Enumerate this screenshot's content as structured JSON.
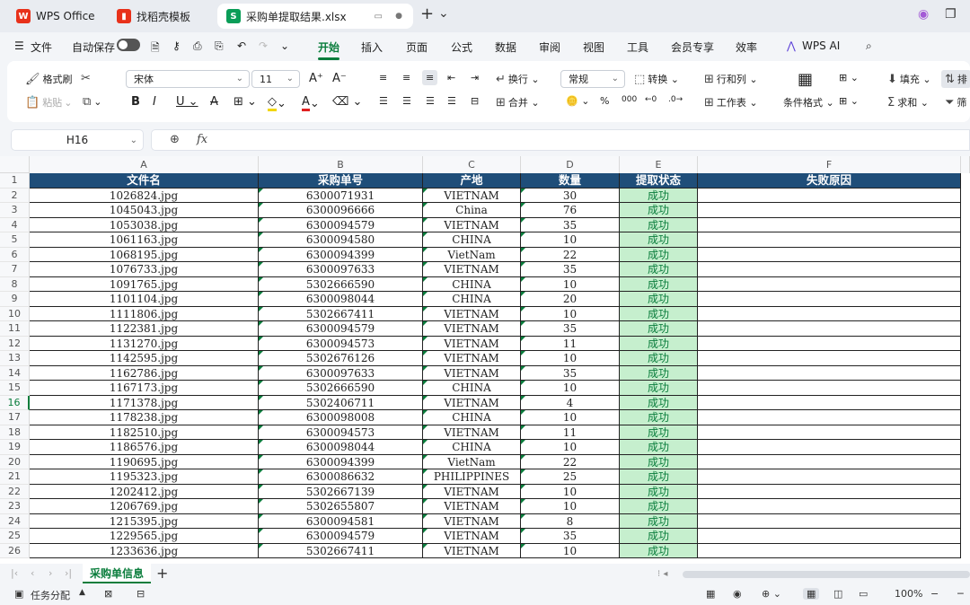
{
  "titlebar": {
    "tabs": [
      {
        "label": "WPS Office",
        "icon": "wps-logo-icon",
        "color": "#e8311a"
      },
      {
        "label": "找稻壳模板",
        "icon": "docer-icon",
        "color": "#e8311a"
      },
      {
        "label": "采购单提取结果.xlsx",
        "icon": "spreadsheet-s-icon",
        "color": "#0a9d58"
      }
    ],
    "new_tab": "+",
    "tab_list": "⌄"
  },
  "menu": {
    "file": "文件",
    "autosave": "自动保存",
    "tabs": [
      "开始",
      "插入",
      "页面",
      "公式",
      "数据",
      "审阅",
      "视图",
      "工具",
      "会员专享",
      "效率"
    ],
    "ai": "WPS AI"
  },
  "ribbon": {
    "format_painter": "格式刷",
    "paste": "粘贴",
    "font_name": "宋体",
    "font_size": "11",
    "wrap": "换行",
    "merge": "合并",
    "number_format": "常规",
    "convert": "转换",
    "rows_cols": "行和列",
    "worksheet": "工作表",
    "cond_format": "条件格式",
    "fill": "填充",
    "sum": "求和",
    "sort": "排",
    "filter": "筛"
  },
  "formula": {
    "cell_ref": "H16",
    "fx": "fx",
    "value": ""
  },
  "columns": [
    "A",
    "B",
    "C",
    "D",
    "E",
    "F"
  ],
  "headers": [
    "文件名",
    "采购单号",
    "产地",
    "数量",
    "提取状态",
    "失败原因"
  ],
  "rows": [
    [
      "1026824.jpg",
      "6300071931",
      "VIETNAM",
      "30",
      "成功",
      ""
    ],
    [
      "1045043.jpg",
      "6300096666",
      "China",
      "76",
      "成功",
      ""
    ],
    [
      "1053038.jpg",
      "6300094579",
      "VIETNAM",
      "35",
      "成功",
      ""
    ],
    [
      "1061163.jpg",
      "6300094580",
      "CHINA",
      "10",
      "成功",
      ""
    ],
    [
      "1068195.jpg",
      "6300094399",
      "VietNam",
      "22",
      "成功",
      ""
    ],
    [
      "1076733.jpg",
      "6300097633",
      "VIETNAM",
      "35",
      "成功",
      ""
    ],
    [
      "1091765.jpg",
      "5302666590",
      "CHINA",
      "10",
      "成功",
      ""
    ],
    [
      "1101104.jpg",
      "6300098044",
      "CHINA",
      "20",
      "成功",
      ""
    ],
    [
      "1111806.jpg",
      "5302667411",
      "VIETNAM",
      "10",
      "成功",
      ""
    ],
    [
      "1122381.jpg",
      "6300094579",
      "VIETNAM",
      "35",
      "成功",
      ""
    ],
    [
      "1131270.jpg",
      "6300094573",
      "VIETNAM",
      "11",
      "成功",
      ""
    ],
    [
      "1142595.jpg",
      "5302676126",
      "VIETNAM",
      "10",
      "成功",
      ""
    ],
    [
      "1162786.jpg",
      "6300097633",
      "VIETNAM",
      "35",
      "成功",
      ""
    ],
    [
      "1167173.jpg",
      "5302666590",
      "CHINA",
      "10",
      "成功",
      ""
    ],
    [
      "1171378.jpg",
      "5302406711",
      "VIETNAM",
      "4",
      "成功",
      ""
    ],
    [
      "1178238.jpg",
      "6300098008",
      "CHINA",
      "10",
      "成功",
      ""
    ],
    [
      "1182510.jpg",
      "6300094573",
      "VIETNAM",
      "11",
      "成功",
      ""
    ],
    [
      "1186576.jpg",
      "6300098044",
      "CHINA",
      "10",
      "成功",
      ""
    ],
    [
      "1190695.jpg",
      "6300094399",
      "VietNam",
      "22",
      "成功",
      ""
    ],
    [
      "1195323.jpg",
      "6300086632",
      "PHILIPPINES",
      "25",
      "成功",
      ""
    ],
    [
      "1202412.jpg",
      "5302667139",
      "VIETNAM",
      "10",
      "成功",
      ""
    ],
    [
      "1206769.jpg",
      "5302655807",
      "VIETNAM",
      "10",
      "成功",
      ""
    ],
    [
      "1215395.jpg",
      "6300094581",
      "VIETNAM",
      "8",
      "成功",
      ""
    ],
    [
      "1229565.jpg",
      "6300094579",
      "VIETNAM",
      "35",
      "成功",
      ""
    ],
    [
      "1233636.jpg",
      "5302667411",
      "VIETNAM",
      "10",
      "成功",
      ""
    ]
  ],
  "selected_row": 16,
  "sheet": {
    "name": "采购单信息",
    "add": "+"
  },
  "status": {
    "task": "任务分配",
    "zoom": "100%"
  },
  "colors": {
    "accent": "#0a7d3c",
    "header_fill": "#1f4e79",
    "success_fill": "#c6efce"
  }
}
